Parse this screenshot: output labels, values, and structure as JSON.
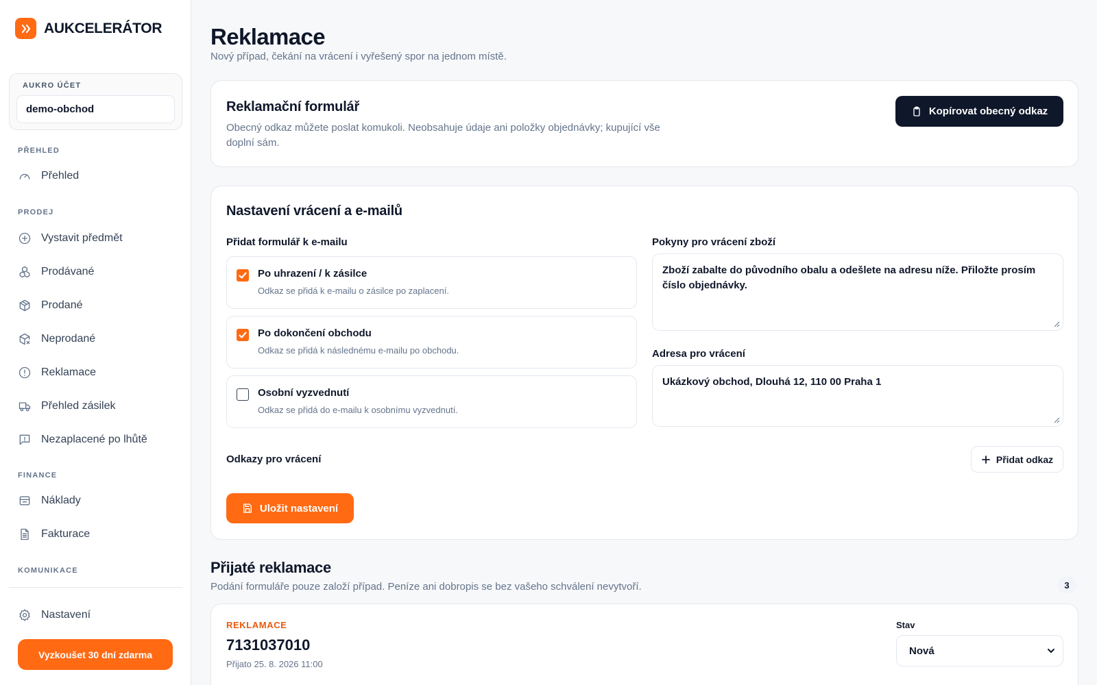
{
  "brand": {
    "name": "AUKCELERÁTOR",
    "accent": "#ff6a13"
  },
  "account": {
    "label": "AUKRO ÚČET",
    "value": "demo-obchod"
  },
  "sidebar": {
    "sections": {
      "overview": "PŘEHLED",
      "sales": "PRODEJ",
      "finance": "FINANCE",
      "communication": "KOMUNIKACE"
    },
    "items": [
      {
        "label": "Přehled",
        "icon": "gauge-icon"
      },
      {
        "label": "Vystavit předmět",
        "icon": "plus-circle-icon"
      },
      {
        "label": "Prodávané",
        "icon": "boxes-icon"
      },
      {
        "label": "Prodané",
        "icon": "package-icon"
      },
      {
        "label": "Neprodané",
        "icon": "package-x-icon"
      },
      {
        "label": "Reklamace",
        "icon": "alert-circle-icon"
      },
      {
        "label": "Přehled zásilek",
        "icon": "truck-icon"
      },
      {
        "label": "Nezaplacené po lhůtě",
        "icon": "message-alert-icon"
      },
      {
        "label": "Náklady",
        "icon": "wallet-icon"
      },
      {
        "label": "Fakturace",
        "icon": "document-icon"
      },
      {
        "label": "Nastavení",
        "icon": "gear-icon"
      }
    ],
    "trial_button": "Vyzkoušet 30 dní zdarma"
  },
  "page": {
    "title": "Reklamace",
    "subtitle": "Nový případ, čekání na vrácení i vyřešený spor na jednom místě."
  },
  "claim_form": {
    "title": "Reklamační formulář",
    "description_line1": "Obecný odkaz můžete poslat komukoli. Neobsahuje údaje ani položky objednávky; kupující vše",
    "description_line2": "doplní sám.",
    "copy_button": "Kopírovat obecný odkaz"
  },
  "settings": {
    "title": "Nastavení vrácení a e-mailů",
    "attach_label": "Přidat formulář k e-mailu",
    "options": [
      {
        "title": "Po uhrazení / k zásilce",
        "desc": "Odkaz se přidá k e-mailu o zásilce po zaplacení.",
        "checked": true
      },
      {
        "title": "Po dokončení obchodu",
        "desc": "Odkaz se přidá k následnému e-mailu po obchodu.",
        "checked": true
      },
      {
        "title": "Osobní vyzvednutí",
        "desc": "Odkaz se přidá do e-mailu k osobnímu vyzvednutí.",
        "checked": false
      }
    ],
    "instructions_label": "Pokyny pro vrácení zboží",
    "instructions_value": "Zboží zabalte do původního obalu a odešlete na adresu níže. Přiložte prosím číslo objednávky.",
    "address_label": "Adresa pro vrácení",
    "address_value": "Ukázkový obchod, Dlouhá 12, 110 00 Praha 1",
    "links_label": "Odkazy pro vrácení",
    "add_link_button": "Přidat odkaz",
    "save_button": "Uložit nastavení"
  },
  "received": {
    "title": "Přijaté reklamace",
    "subtitle": "Podání formuláře pouze založí případ. Peníze ani dobropis se bez vašeho schválení nevytvoří.",
    "count": "3",
    "claims": [
      {
        "kind": "REKLAMACE",
        "id": "7131037010",
        "received": "Přijato 25. 8. 2026 11:00",
        "status_label": "Stav",
        "status_value": "Nová"
      }
    ]
  }
}
